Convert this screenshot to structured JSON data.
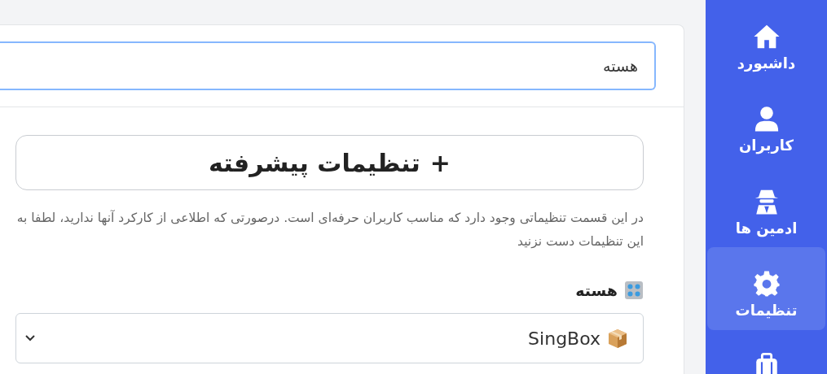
{
  "search": {
    "value": "هسته",
    "focused": true
  },
  "advanced_button": {
    "icon_text": "+",
    "label": "تنظیمات پیشرفته"
  },
  "notice": "در این قسمت تنظیماتی وجود دارد که مناسب کاربران حرفه‌ای است. درصورتی که اطلاعی از کارکرد آنها ندارید، لطفا به این تنظیمات دست نزنید",
  "core_field": {
    "label": "هسته",
    "value": "SingBox"
  },
  "sidebar": {
    "items": [
      {
        "label": "داشبورد",
        "selected": false
      },
      {
        "label": "کاربران",
        "selected": false
      },
      {
        "label": "ادمین ها",
        "selected": false
      },
      {
        "label": "تنظیمات",
        "selected": true
      },
      {
        "selected": false
      }
    ]
  }
}
